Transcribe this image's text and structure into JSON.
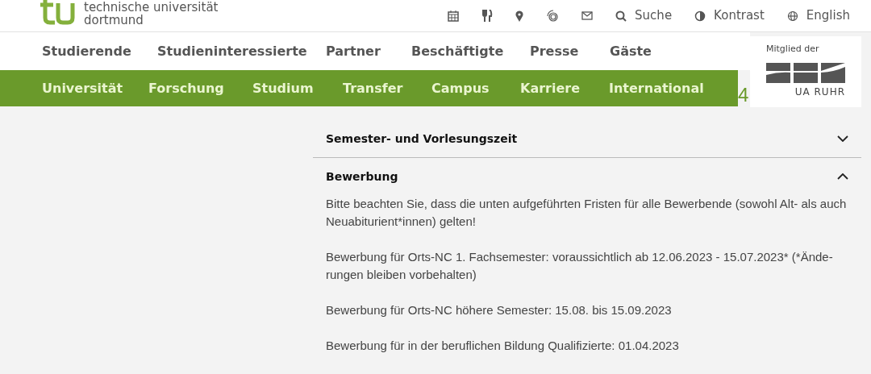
{
  "logo": {
    "line_1": "technische universität",
    "line_2": "dortmund"
  },
  "utility_links": [
    {
      "kind": "search",
      "label": "Suche"
    },
    {
      "kind": "contrast",
      "label": "Kontrast"
    },
    {
      "kind": "language",
      "label": "English"
    }
  ],
  "audience_nav": [
    "Studierende",
    "Studieninteressierte",
    "Partner",
    "Beschäftigte",
    "Presse",
    "Gäste"
  ],
  "main_nav": [
    "Universität",
    "Forschung",
    "Studium",
    "Transfer",
    "Campus",
    "Karriere",
    "International"
  ],
  "cut_text": "4",
  "ua_ruhr": {
    "caption": "Mitglied der",
    "name": "UA RUHR"
  },
  "accordion": [
    {
      "title": "Semester- und Vorlesungszeit",
      "expanded": false
    },
    {
      "title": "Bewerbung",
      "expanded": true,
      "paragraphs": [
        "Bitte beachten Sie, dass die unten aufgeführten Fristen für alle Bewerbende (sowohl Alt- als auch Neuabiturient*innen) gelten!",
        "Bewerbung für Orts-NC 1. Fachsemester: voraussichtlich ab 12.06.2023 - 15.07.2023* (*Ände-rungen bleiben vorbehalten)",
        "Bewerbung für Orts-NC höhere Semester: 15.08. bis 15.09.2023",
        "Bewerbung für in der beruflichen Bildung Qualifizierte: 01.04.2023"
      ]
    }
  ]
}
